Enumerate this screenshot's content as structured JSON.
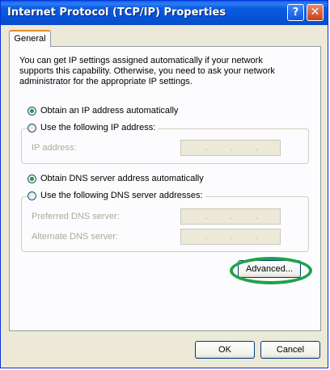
{
  "window": {
    "title": "Internet Protocol (TCP/IP) Properties",
    "help_glyph": "?",
    "close_glyph": "✕"
  },
  "tabs": [
    {
      "label": "General"
    }
  ],
  "description": "You can get IP settings assigned automatically if your network supports this capability. Otherwise, you need to ask your network administrator for the appropriate IP settings.",
  "ip": {
    "auto_label": "Obtain an IP address automatically",
    "auto_selected": true,
    "manual_label": "Use the following IP address:",
    "manual_selected": false,
    "address_label": "IP address:"
  },
  "dns": {
    "auto_label": "Obtain DNS server address automatically",
    "auto_selected": true,
    "manual_label": "Use the following DNS server addresses:",
    "manual_selected": false,
    "preferred_label": "Preferred DNS server:",
    "alternate_label": "Alternate DNS server:"
  },
  "buttons": {
    "advanced": "Advanced...",
    "ok": "OK",
    "cancel": "Cancel"
  },
  "annotation": {
    "color": "#1ea24a"
  }
}
